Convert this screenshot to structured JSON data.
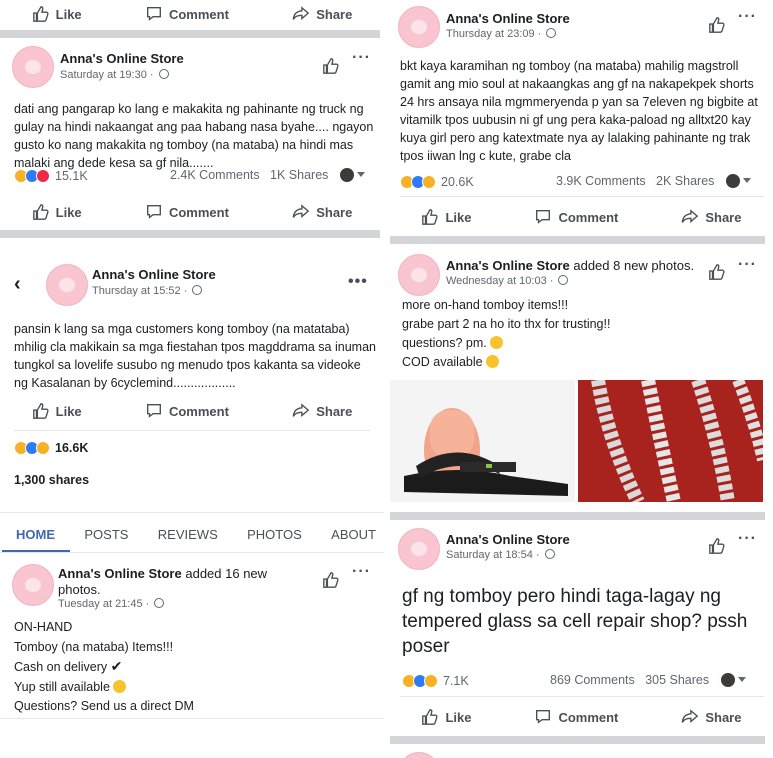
{
  "icons": {
    "like": "thumbs-up-icon",
    "comment": "speech-bubble-icon",
    "share": "arrow-share-icon",
    "privacy": "globe-icon",
    "more": "ellipsis-icon"
  },
  "colors": {
    "accent": "#4267b2",
    "separator": "#d3d5d9",
    "avatar": "#f9c5d1"
  },
  "actions": {
    "like": "Like",
    "comment": "Comment",
    "share": "Share"
  },
  "top_left": {
    "like": "Like",
    "comment": "Comment",
    "share": "Share"
  },
  "posts": {
    "p1": {
      "page_name": "Anna's Online Store",
      "timestamp": "Saturday at 19:30 ·",
      "text": "dati ang pangarap ko lang e makakita ng pahinante ng truck ng gulay na hindi nakaangat ang paa habang nasa byahe.... ngayon gusto ko nang makakita ng tomboy (na mataba) na hindi mas malaki ang dede kesa sa gf nila.......",
      "reactions": "15.1K",
      "comments": "2.4K Comments",
      "shares": "1K Shares"
    },
    "p2": {
      "page_name": "Anna's Online Store",
      "timestamp": "Thursday at 15:52 ·",
      "more": "•••",
      "text": "pansin k lang sa mga customers kong tomboy (na matataba) mhilig cla makikain sa mga fiestahan tpos magddrama sa inuman tungkol sa lovelife susubo ng menudo tpos kakanta sa videoke ng Kasalanan by 6cyclemind..................",
      "reactions": "16.6K",
      "shares": "1,300 shares"
    },
    "p3": {
      "page_name": "Anna's Online Store",
      "added": "added 16 new photos.",
      "timestamp": "Tuesday at 21:45 ·",
      "line1": "ON-HAND",
      "line2": "Tomboy (na mataba) Items!!!",
      "line3": "Cash on delivery",
      "line4": "Yup still available",
      "line5": "Questions? Send us a direct DM"
    },
    "r1": {
      "page_name": "Anna's Online Store",
      "timestamp": "Thursday at 23:09 ·",
      "text": "bkt kaya karamihan ng tomboy (na mataba) mahilig magstroll gamit ang mio soul at nakaangkas ang gf na nakapekpek shorts 24 hrs ansaya nila mgmmeryenda p yan sa 7eleven ng bigbite at vitamilk tpos uubusin ni gf ung pera kaka-paload ng alltxt20 kay kuya girl pero ang katextmate nya ay lalaking pahinante ng trak tpos iiwan lng c kute, grabe cla",
      "reactions": "20.6K",
      "comments": "3.9K Comments",
      "shares": "2K Shares"
    },
    "r2": {
      "page_name": "Anna's Online Store",
      "added": "added 8 new photos.",
      "timestamp": "Wednesday at 10:03 ·",
      "line1": "more on-hand tomboy items!!!",
      "line2": "grabe part 2 na ho ito thx for trusting!!",
      "line3": "questions? pm.",
      "line4": "COD available"
    },
    "r3": {
      "page_name": "Anna's Online Store",
      "timestamp": "Saturday at 18:54 ·",
      "text": "gf ng tomboy pero hindi taga-lagay ng tempered glass sa cell repair shop? pssh poser",
      "reactions": "7.1K",
      "comments": "869 Comments",
      "shares": "305 Shares"
    }
  },
  "tabs": [
    "HOME",
    "POSTS",
    "REVIEWS",
    "PHOTOS",
    "ABOUT"
  ]
}
